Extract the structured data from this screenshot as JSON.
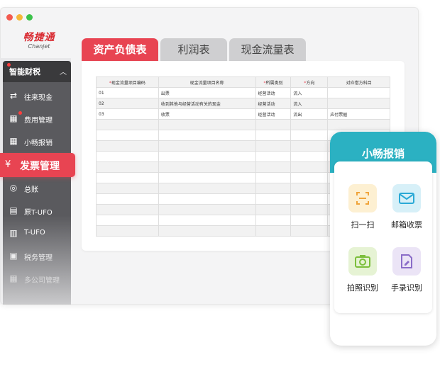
{
  "brand": {
    "name_cn": "畅捷通",
    "name_en": "Chanjet",
    "color": "#d92b32"
  },
  "sidebar": {
    "header_label": "智能财税",
    "items": [
      {
        "label": "往来现金",
        "icon": "transfer-icon"
      },
      {
        "label": "费用管理",
        "icon": "expense-icon",
        "badge_dot": true
      },
      {
        "label": "小畅报销",
        "icon": "reimburse-icon"
      },
      {
        "label": "发票管理",
        "icon": "invoice-icon",
        "active": true
      },
      {
        "label": "总账",
        "icon": "ledger-icon"
      },
      {
        "label": "原T-UFO",
        "icon": "ufo-icon"
      },
      {
        "label": "T-UFO",
        "icon": "report-icon"
      },
      {
        "label": "税务管理",
        "icon": "tax-icon"
      },
      {
        "label": "多公司管理",
        "icon": "company-icon"
      }
    ]
  },
  "tabs": [
    {
      "label": "资产负债表",
      "active": true
    },
    {
      "label": "利润表"
    },
    {
      "label": "现金流量表"
    }
  ],
  "table": {
    "columns": [
      "*现金流量项目编码",
      "现金流量项目名称",
      "*所属类别",
      "*方向",
      "对应借方科目"
    ],
    "rows": [
      [
        "01",
        "出票",
        "经营活动",
        "流入",
        ""
      ],
      [
        "02",
        "收到其他与经营活动有关的现金",
        "经营活动",
        "流入",
        ""
      ],
      [
        "03",
        "收票",
        "经营活动",
        "流出",
        "应付票据"
      ]
    ],
    "empty_rows": 11
  },
  "phone": {
    "title": "小畅报销",
    "header_color": "#2bb1c2",
    "features": [
      {
        "label": "扫一扫",
        "icon": "scan-icon"
      },
      {
        "label": "邮箱收票",
        "icon": "mail-icon"
      },
      {
        "label": "拍照识别",
        "icon": "camera-icon"
      },
      {
        "label": "手录识别",
        "icon": "manual-entry-icon"
      }
    ]
  },
  "accent_color": "#e84452"
}
